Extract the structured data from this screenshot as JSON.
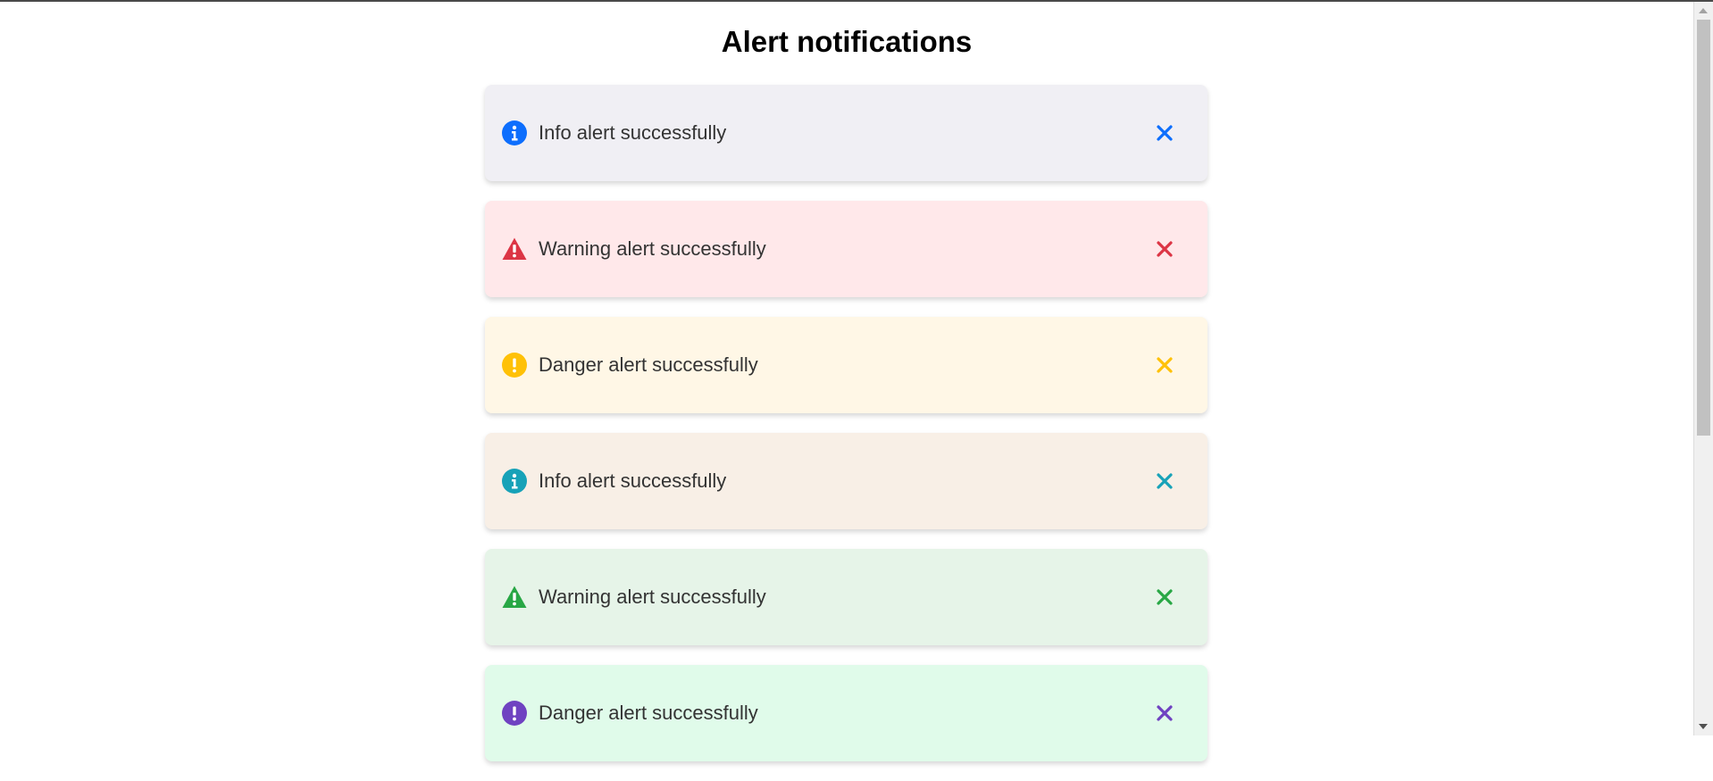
{
  "page": {
    "title": "Alert notifications"
  },
  "alerts": [
    {
      "message": "Info alert successfully",
      "icon": "info-circle-icon",
      "bg": "#f0eff4",
      "color": "#0d6efd"
    },
    {
      "message": "Warning alert successfully",
      "icon": "warning-triangle-icon",
      "bg": "#ffe8ea",
      "color": "#dc3545"
    },
    {
      "message": "Danger alert successfully",
      "icon": "exclamation-circle-icon",
      "bg": "#fff7e6",
      "color": "#ffc107"
    },
    {
      "message": "Info alert successfully",
      "icon": "info-circle-icon",
      "bg": "#f8efe6",
      "color": "#17a2b8"
    },
    {
      "message": "Warning alert successfully",
      "icon": "warning-triangle-icon",
      "bg": "#e6f4e8",
      "color": "#28a745"
    },
    {
      "message": "Danger alert successfully",
      "icon": "exclamation-circle-icon",
      "bg": "#e0fbea",
      "color": "#6f42c1"
    }
  ],
  "close_icon": "close-icon"
}
